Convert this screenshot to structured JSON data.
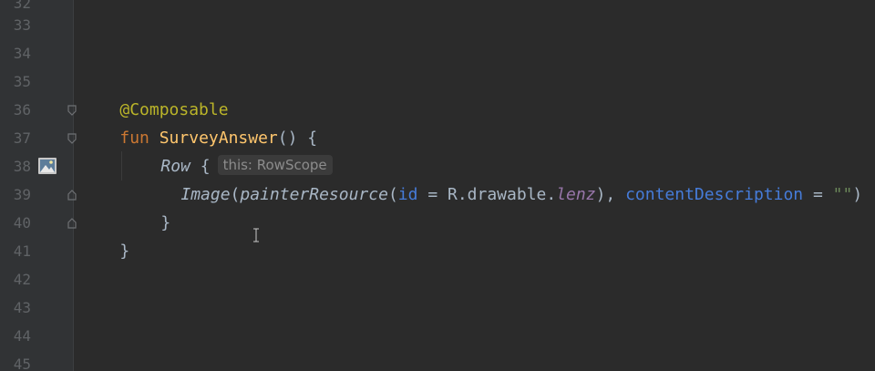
{
  "editor": {
    "line_numbers": [
      "32",
      "33",
      "34",
      "35",
      "36",
      "37",
      "38",
      "39",
      "40",
      "41",
      "42",
      "43",
      "44",
      "45"
    ],
    "code": {
      "l35_annotation": "@Composable",
      "l36_keyword": "fun",
      "l36_fn_name": "SurveyAnswer",
      "l36_rest": "() {",
      "l37_call": "Row",
      "l37_brace": " {",
      "l37_inlay_hint": "this: RowScope",
      "l38_call": "Image",
      "l38_open": "(",
      "l38_painter": "painterResource",
      "l38_paren": "(",
      "l38_id_param": "id",
      "l38_eq1": " = R.drawable.",
      "l38_field": "lenz",
      "l38_close": "), ",
      "l38_cd_param": "contentDescription",
      "l38_eq2": " = ",
      "l38_string": "\"\"",
      "l38_end": ")",
      "l39_brace": "}",
      "l40_brace": "}"
    },
    "icons": {
      "gutter_image": "image-preview-icon",
      "fold": "fold-marker-icon",
      "cursor": "text-cursor-icon"
    },
    "colors": {
      "background": "#2b2b2b",
      "gutter": "#313335",
      "annotation": "#bbb529",
      "keyword": "#cc7832",
      "function_declaration": "#ffc66d",
      "parameter_name": "#467cda",
      "field": "#9876aa",
      "string": "#6a8759",
      "default_text": "#a9b7c6"
    }
  }
}
